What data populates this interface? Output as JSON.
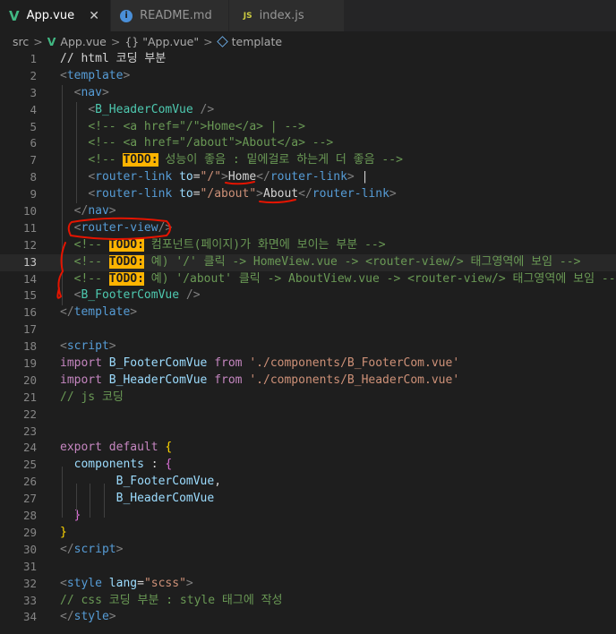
{
  "tabs": [
    {
      "label": "App.vue",
      "icon": "vue-icon",
      "active": true,
      "close": "✕"
    },
    {
      "label": "README.md",
      "icon": "info-icon",
      "active": false
    },
    {
      "label": "index.js",
      "icon": "js-icon",
      "active": false
    }
  ],
  "tab_icon_text": {
    "vue": "V",
    "info": "i",
    "js": "JS"
  },
  "breadcrumb": {
    "folder": "src",
    "file": "App.vue",
    "braces": "{}",
    "component": "\"App.vue\"",
    "section": "template",
    "separator": ">"
  },
  "lines": [
    {
      "n": "1",
      "tokens": [
        [
          "plain",
          "// html 코딩 부분"
        ]
      ]
    },
    {
      "n": "2",
      "tokens": [
        [
          "punct",
          "<"
        ],
        [
          "tag",
          "template"
        ],
        [
          "punct",
          ">"
        ]
      ]
    },
    {
      "n": "3",
      "tokens": [
        [
          "plain",
          "  "
        ],
        [
          "punct",
          "<"
        ],
        [
          "tag",
          "nav"
        ],
        [
          "punct",
          ">"
        ]
      ]
    },
    {
      "n": "4",
      "tokens": [
        [
          "plain",
          "    "
        ],
        [
          "punct",
          "<"
        ],
        [
          "comp",
          "B_HeaderComVue"
        ],
        [
          "plain",
          " "
        ],
        [
          "punct",
          "/>"
        ]
      ]
    },
    {
      "n": "5",
      "tokens": [
        [
          "plain",
          "    "
        ],
        [
          "cmt",
          "<!-- <a href=\"/\">Home</a> | -->"
        ]
      ]
    },
    {
      "n": "6",
      "tokens": [
        [
          "plain",
          "    "
        ],
        [
          "cmt",
          "<!-- <a href=\"/about\">About</a> -->"
        ]
      ]
    },
    {
      "n": "7",
      "tokens": [
        [
          "plain",
          "    "
        ],
        [
          "cmt",
          "<!-- "
        ],
        [
          "todo",
          "TODO:"
        ],
        [
          "cmt",
          " 성능이 좋음 : 밑에걸로 하는게 더 좋음 -->"
        ]
      ]
    },
    {
      "n": "8",
      "tokens": [
        [
          "plain",
          "    "
        ],
        [
          "punct",
          "<"
        ],
        [
          "tag",
          "router-link"
        ],
        [
          "plain",
          " "
        ],
        [
          "attr",
          "to"
        ],
        [
          "plain",
          "="
        ],
        [
          "str",
          "\"/\""
        ],
        [
          "punct",
          ">"
        ],
        [
          "plain",
          "Home"
        ],
        [
          "punct",
          "</"
        ],
        [
          "tag",
          "router-link"
        ],
        [
          "punct",
          ">"
        ],
        [
          "plain",
          " |"
        ]
      ]
    },
    {
      "n": "9",
      "tokens": [
        [
          "plain",
          "    "
        ],
        [
          "punct",
          "<"
        ],
        [
          "tag",
          "router-link"
        ],
        [
          "plain",
          " "
        ],
        [
          "attr",
          "to"
        ],
        [
          "plain",
          "="
        ],
        [
          "str",
          "\"/about\""
        ],
        [
          "punct",
          ">"
        ],
        [
          "plain",
          "About"
        ],
        [
          "punct",
          "</"
        ],
        [
          "tag",
          "router-link"
        ],
        [
          "punct",
          ">"
        ]
      ]
    },
    {
      "n": "10",
      "tokens": [
        [
          "plain",
          "  "
        ],
        [
          "punct",
          "</"
        ],
        [
          "tag",
          "nav"
        ],
        [
          "punct",
          ">"
        ]
      ]
    },
    {
      "n": "11",
      "tokens": [
        [
          "plain",
          "  "
        ],
        [
          "punct",
          "<"
        ],
        [
          "tag",
          "router-view"
        ],
        [
          "punct",
          "/>"
        ]
      ]
    },
    {
      "n": "12",
      "tokens": [
        [
          "plain",
          "  "
        ],
        [
          "cmt",
          "<!-- "
        ],
        [
          "todo",
          "TODO:"
        ],
        [
          "cmt",
          " 컴포넌트(페이지)가 화면에 보이는 부분 -->"
        ]
      ]
    },
    {
      "n": "13",
      "tokens": [
        [
          "plain",
          "  "
        ],
        [
          "cmt",
          "<!-- "
        ],
        [
          "todo",
          "TODO:"
        ],
        [
          "cmt",
          " 예) '/' 클릭 -> HomeView.vue -> <router-view/> 태그영역에 보임 -->"
        ]
      ]
    },
    {
      "n": "14",
      "tokens": [
        [
          "plain",
          "  "
        ],
        [
          "cmt",
          "<!-- "
        ],
        [
          "todo",
          "TODO:"
        ],
        [
          "cmt",
          " 예) '/about' 클릭 -> AboutView.vue -> <router-view/> 태그영역에 보임 -->"
        ]
      ]
    },
    {
      "n": "15",
      "tokens": [
        [
          "plain",
          "  "
        ],
        [
          "punct",
          "<"
        ],
        [
          "comp",
          "B_FooterComVue"
        ],
        [
          "plain",
          " "
        ],
        [
          "punct",
          "/>"
        ]
      ]
    },
    {
      "n": "16",
      "tokens": [
        [
          "punct",
          "</"
        ],
        [
          "tag",
          "template"
        ],
        [
          "punct",
          ">"
        ]
      ]
    },
    {
      "n": "17",
      "tokens": []
    },
    {
      "n": "18",
      "tokens": [
        [
          "punct",
          "<"
        ],
        [
          "tag",
          "script"
        ],
        [
          "punct",
          ">"
        ]
      ]
    },
    {
      "n": "19",
      "tokens": [
        [
          "kw",
          "import"
        ],
        [
          "plain",
          " "
        ],
        [
          "var",
          "B_FooterComVue"
        ],
        [
          "plain",
          " "
        ],
        [
          "kw",
          "from"
        ],
        [
          "plain",
          " "
        ],
        [
          "str",
          "'./components/B_FooterCom.vue'"
        ]
      ]
    },
    {
      "n": "20",
      "tokens": [
        [
          "kw",
          "import"
        ],
        [
          "plain",
          " "
        ],
        [
          "var",
          "B_HeaderComVue"
        ],
        [
          "plain",
          " "
        ],
        [
          "kw",
          "from"
        ],
        [
          "plain",
          " "
        ],
        [
          "str",
          "'./components/B_HeaderCom.vue'"
        ]
      ]
    },
    {
      "n": "21",
      "tokens": [
        [
          "cmt",
          "// js 코딩"
        ]
      ]
    },
    {
      "n": "22",
      "tokens": []
    },
    {
      "n": "23",
      "tokens": []
    },
    {
      "n": "24",
      "tokens": [
        [
          "kw",
          "export"
        ],
        [
          "plain",
          " "
        ],
        [
          "kw",
          "default"
        ],
        [
          "plain",
          " "
        ],
        [
          "brace1",
          "{"
        ]
      ]
    },
    {
      "n": "25",
      "tokens": [
        [
          "plain",
          "  "
        ],
        [
          "var",
          "components"
        ],
        [
          "plain",
          " : "
        ],
        [
          "brace2",
          "{"
        ]
      ]
    },
    {
      "n": "26",
      "tokens": [
        [
          "plain",
          "        "
        ],
        [
          "var",
          "B_FooterComVue"
        ],
        [
          "plain",
          ","
        ]
      ]
    },
    {
      "n": "27",
      "tokens": [
        [
          "plain",
          "        "
        ],
        [
          "var",
          "B_HeaderComVue"
        ]
      ]
    },
    {
      "n": "28",
      "tokens": [
        [
          "plain",
          "  "
        ],
        [
          "brace2",
          "}"
        ]
      ]
    },
    {
      "n": "29",
      "tokens": [
        [
          "brace1",
          "}"
        ]
      ]
    },
    {
      "n": "30",
      "tokens": [
        [
          "punct",
          "</"
        ],
        [
          "tag",
          "script"
        ],
        [
          "punct",
          ">"
        ]
      ]
    },
    {
      "n": "31",
      "tokens": []
    },
    {
      "n": "32",
      "tokens": [
        [
          "punct",
          "<"
        ],
        [
          "tag",
          "style"
        ],
        [
          "plain",
          " "
        ],
        [
          "attr",
          "lang"
        ],
        [
          "plain",
          "="
        ],
        [
          "str",
          "\"scss\""
        ],
        [
          "punct",
          ">"
        ]
      ]
    },
    {
      "n": "33",
      "tokens": [
        [
          "cmt",
          "// css 코딩 부분 : style 태그에 작성"
        ]
      ]
    },
    {
      "n": "34",
      "tokens": [
        [
          "punct",
          "</"
        ],
        [
          "tag",
          "style"
        ],
        [
          "punct",
          ">"
        ]
      ]
    }
  ],
  "current_line": "13",
  "colors": {
    "background": "#1e1e1e",
    "annotation": "#e51400",
    "todo_highlight": "#ffb400"
  }
}
